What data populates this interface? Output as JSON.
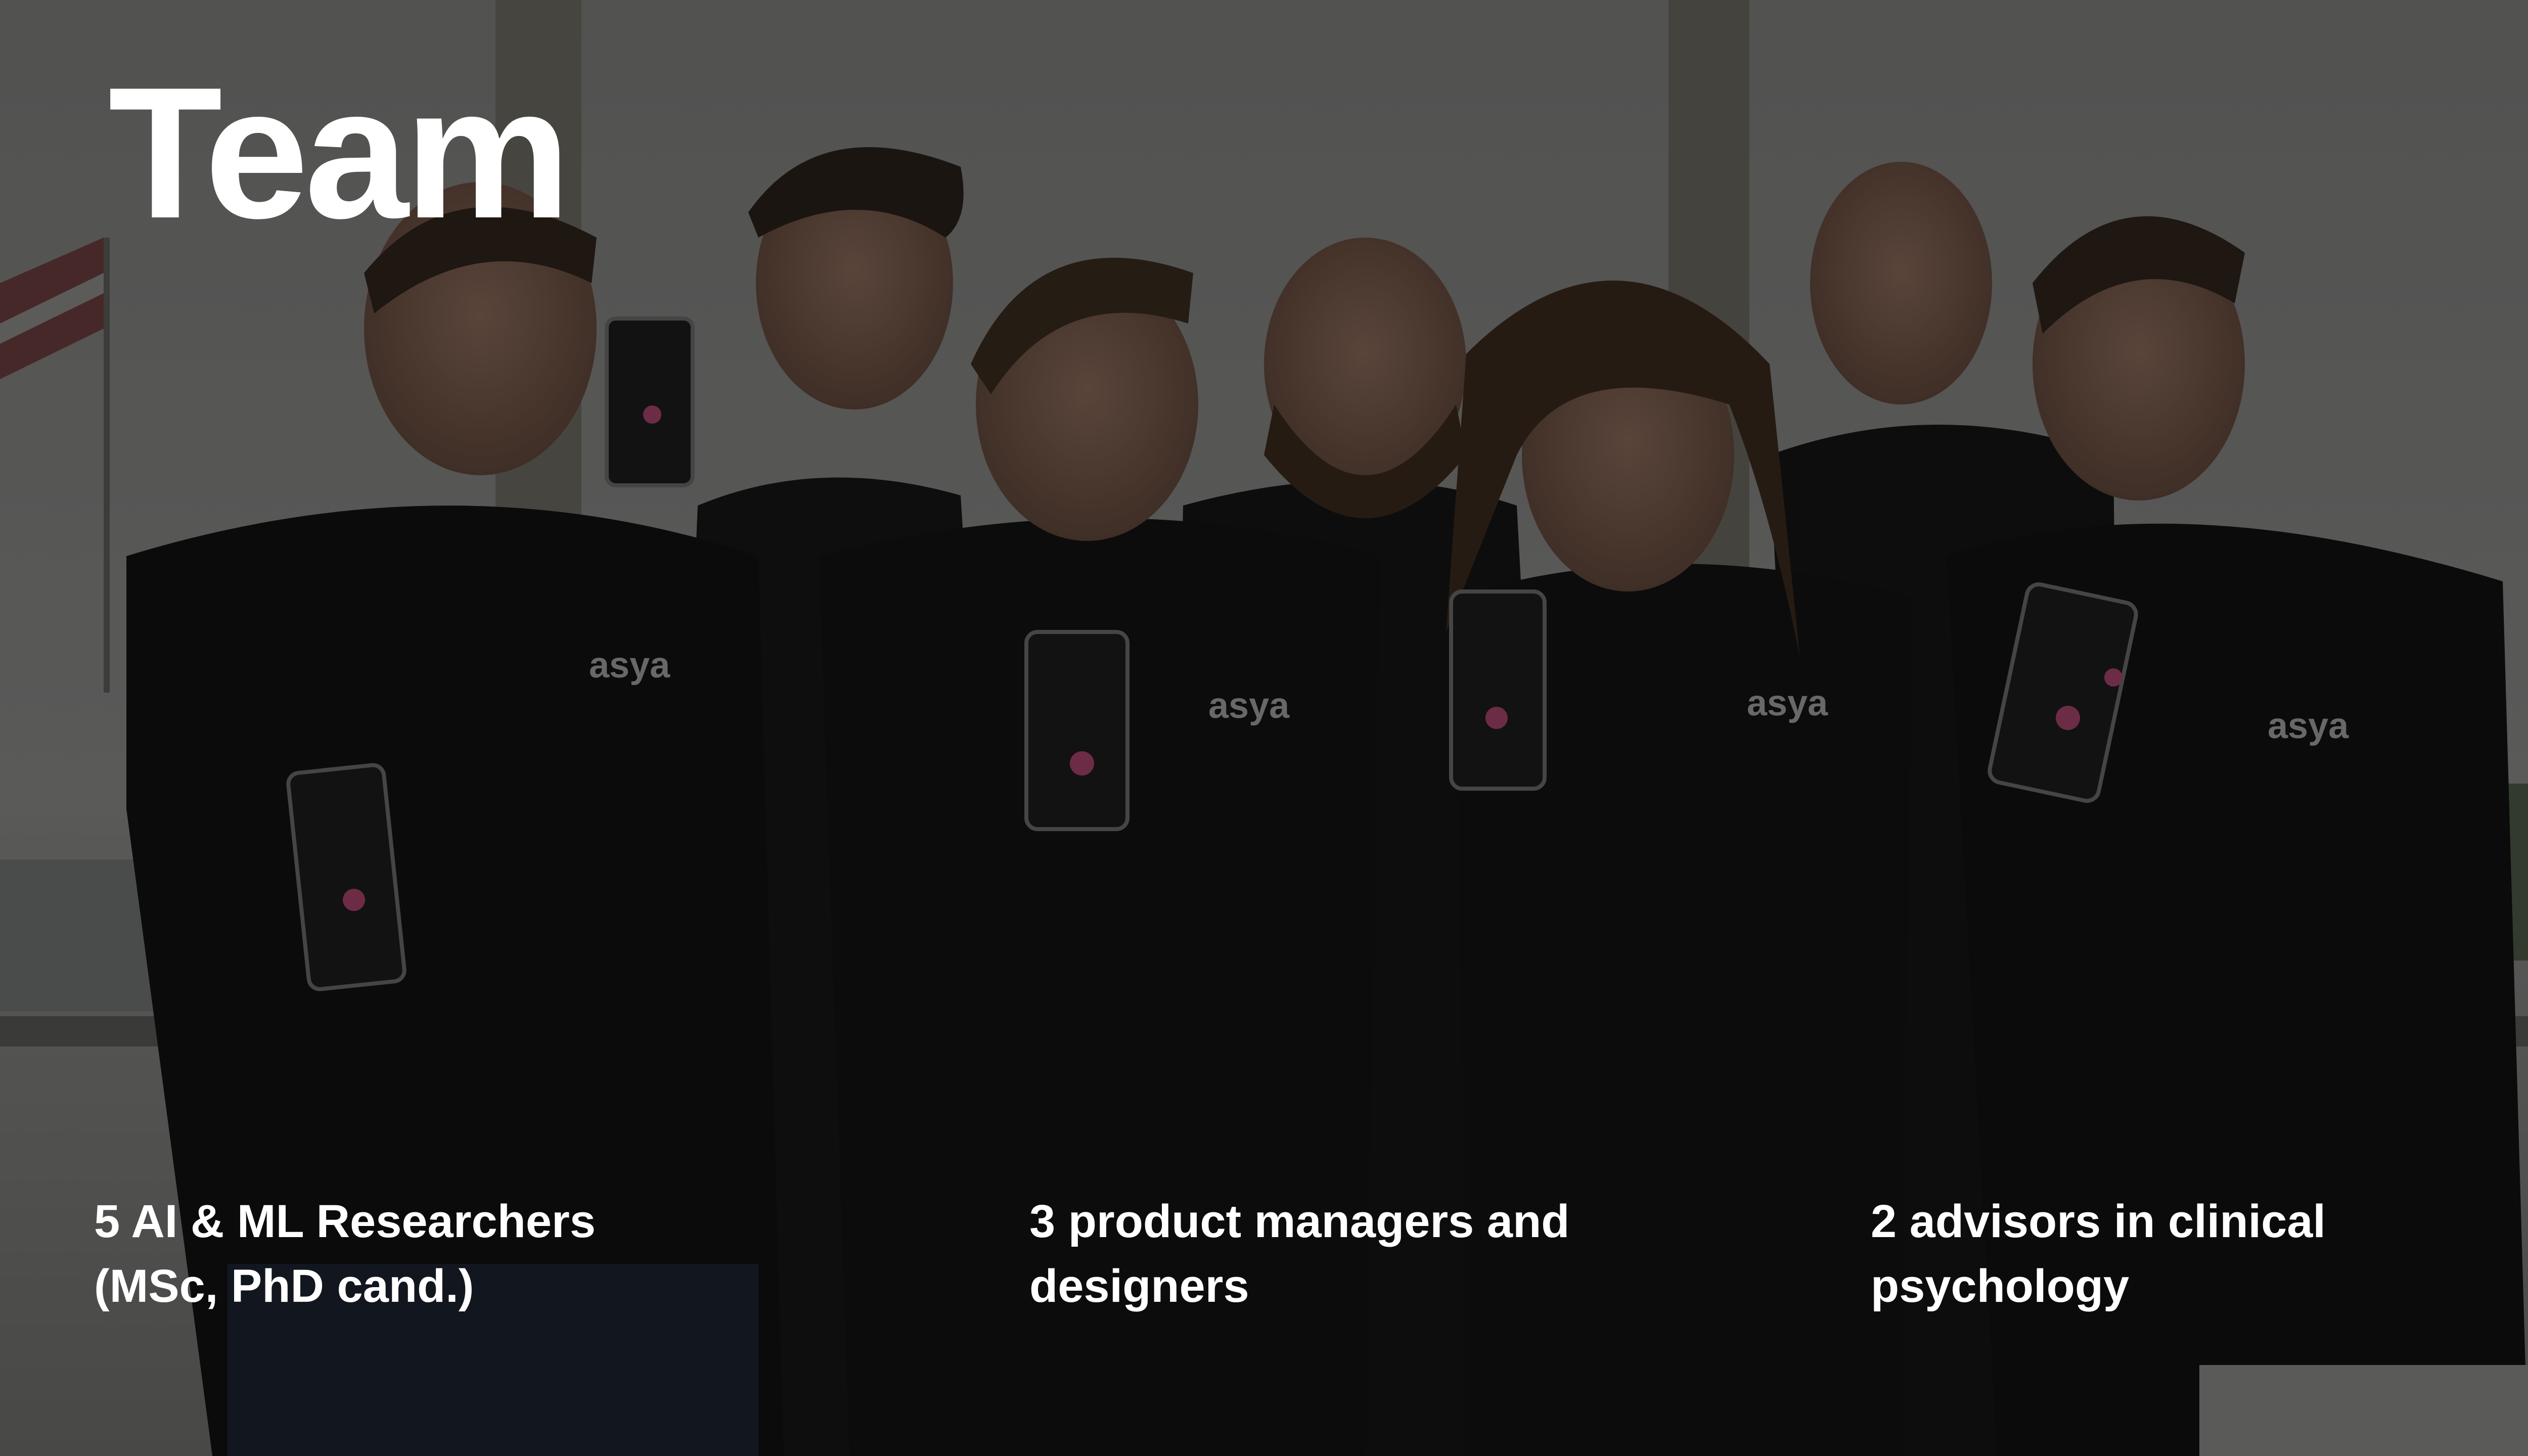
{
  "slide": {
    "title": "Team",
    "shirt_logo": "asya",
    "captions": [
      {
        "line1": "5 AI & ML Researchers",
        "line2": "(MSc, PhD cand.)"
      },
      {
        "line1": "3 product managers and",
        "line2": "designers"
      },
      {
        "line1": "2 advisors in clinical",
        "line2": "psychology"
      }
    ]
  },
  "colors": {
    "text": "#ffffff",
    "shirt": "#141414",
    "window": "#8c8c8a"
  }
}
